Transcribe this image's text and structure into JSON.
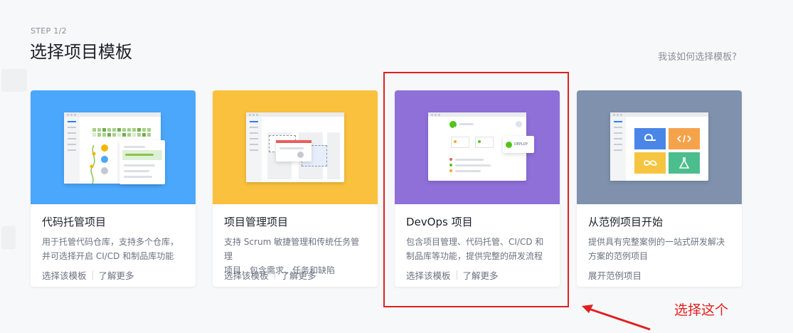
{
  "header": {
    "step": "STEP 1/2",
    "title": "选择项目模板",
    "help_link": "我该如何选择模板?"
  },
  "cards": [
    {
      "title": "代码托管项目",
      "desc_line1": "用于托管代码仓库，支持多个仓库，",
      "desc_line2": "并可选择开启 CI/CD 和制品库功能",
      "action_primary": "选择该模板",
      "action_secondary": "了解更多",
      "color": "#4aa7fb"
    },
    {
      "title": "项目管理项目",
      "desc_line1": "支持 Scrum 敏捷管理和传统任务管理",
      "desc_line2": "项目，包含需求、任务和缺陷",
      "action_primary": "选择该模板",
      "action_secondary": "了解更多",
      "color": "#f9c13d"
    },
    {
      "title": "DevOps 项目",
      "desc_line1": "包含项目管理、代码托管、CI/CD 和",
      "desc_line2": "制品库等功能，提供完整的研发流程",
      "action_primary": "选择该模板",
      "action_secondary": "了解更多",
      "color": "#8f6fd8",
      "banner_badge": "DEPLOY"
    },
    {
      "title": "从范例项目开始",
      "desc_line1": "提供具有完整案例的一站式研发解决",
      "desc_line2": "方案的范例项目",
      "action_primary": "展开范例项目",
      "color": "#7f91ad"
    }
  ],
  "annotation": {
    "text": "选择这个",
    "color": "#e02020"
  },
  "icons": [
    "check-icon",
    "code-icon",
    "infinity-icon",
    "flask-icon",
    "loop-icon"
  ]
}
